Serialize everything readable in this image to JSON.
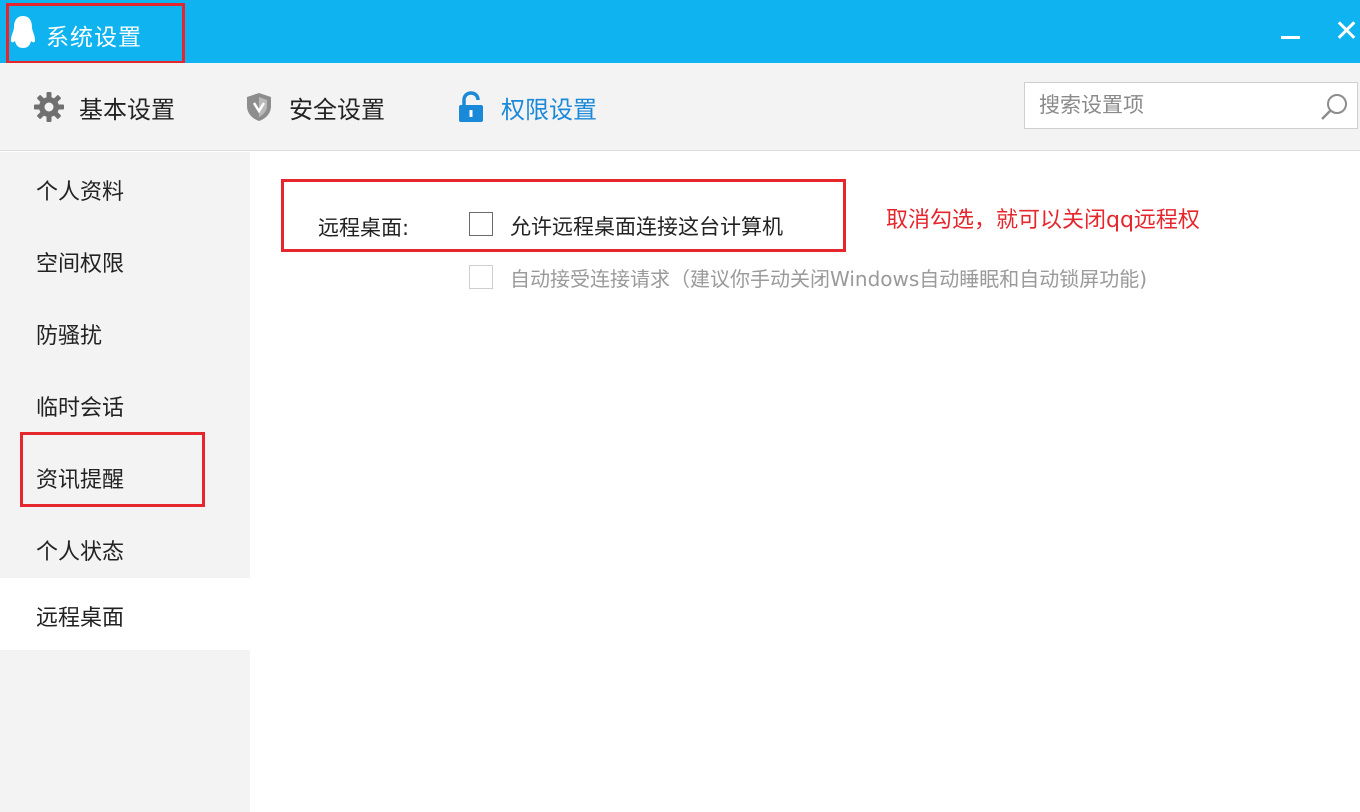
{
  "window": {
    "title": "系统设置",
    "icon": "qq-penguin-icon"
  },
  "titlebar_buttons": {
    "minimize": "minimize-icon",
    "close_label": "✕"
  },
  "tabs": [
    {
      "label": "基本设置",
      "icon": "gear-icon"
    },
    {
      "label": "安全设置",
      "icon": "shield-icon"
    },
    {
      "label": "权限设置",
      "icon": "lock-icon",
      "active": true
    }
  ],
  "search": {
    "placeholder": "搜索设置项",
    "value": "",
    "icon": "search-icon"
  },
  "sidebar": {
    "items": [
      {
        "label": "个人资料"
      },
      {
        "label": "空间权限"
      },
      {
        "label": "防骚扰"
      },
      {
        "label": "临时会话"
      },
      {
        "label": "资讯提醒"
      },
      {
        "label": "个人状态"
      },
      {
        "label": "远程桌面",
        "active": true
      }
    ]
  },
  "remote_desktop": {
    "section_label": "远程桌面:",
    "allow_option": {
      "label": "允许远程桌面连接这台计算机",
      "checked": false
    },
    "auto_accept_option": {
      "label": "自动接受连接请求（建议你手动关闭Windows自动睡眠和自动锁屏功能)",
      "checked": false,
      "disabled": true
    }
  },
  "annotation": {
    "text": "取消勾选，就可以关闭qq远程权"
  },
  "colors": {
    "titlebar": "#0fb3f0",
    "accent": "#1a8ad8",
    "highlight_red": "#e5262d"
  }
}
